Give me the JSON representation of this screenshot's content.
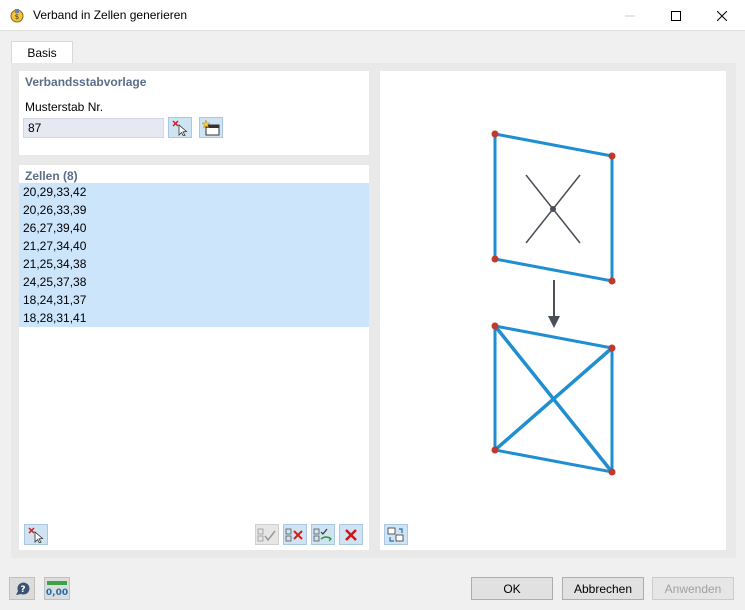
{
  "window": {
    "title": "Verband in Zellen generieren"
  },
  "tabs": [
    {
      "label": "Basis"
    }
  ],
  "template": {
    "section_title": "Verbandsstabvorlage",
    "field_label": "Musterstab Nr.",
    "field_value": "87"
  },
  "cells": {
    "section_title": "Zellen (8)",
    "items": [
      "20,29,33,42",
      "20,26,33,39",
      "26,27,39,40",
      "21,27,34,40",
      "21,25,34,38",
      "24,25,37,38",
      "18,24,31,37",
      "18,28,31,41"
    ]
  },
  "footer": {
    "ok": "OK",
    "cancel": "Abbrechen",
    "apply": "Anwenden",
    "units_icon_text": "0,00"
  },
  "colors": {
    "accent_blue": "#1f8fd1",
    "node_red": "#c0392b",
    "section_title": "#5a6d8a",
    "list_selection": "#cde5fa"
  }
}
